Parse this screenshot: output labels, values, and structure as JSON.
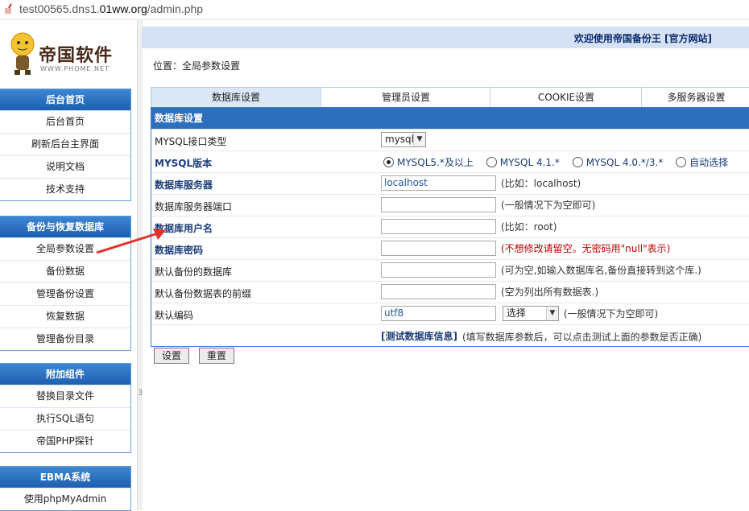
{
  "browser": {
    "url_prefix": "test00565.dns1.",
    "url_host": "01ww.org",
    "url_path": "/admin.php"
  },
  "logo": {
    "brand": "帝国软件",
    "site": "WWW.PHOME.NET"
  },
  "sidebar": {
    "menus": [
      {
        "header": "后台首页",
        "items": [
          "后台首页",
          "刷新后台主界面",
          "说明文档",
          "技术支持"
        ]
      },
      {
        "header": "备份与恢复数据库",
        "items": [
          "全局参数设置",
          "备份数据",
          "管理备份设置",
          "恢复数据",
          "管理备份目录"
        ]
      },
      {
        "header": "附加组件",
        "items": [
          "替换目录文件",
          "执行SQL语句",
          "帝国PHP探针"
        ]
      },
      {
        "header": "EBMA系统",
        "items": [
          "使用phpMyAdmin"
        ]
      }
    ]
  },
  "divider_number": "3",
  "header": {
    "welcome": "欢迎使用帝国备份王 [官方网站]"
  },
  "location": "位置：全局参数设置",
  "tabs": [
    "数据库设置",
    "管理员设置",
    "COOKIE设置",
    "多服务器设置"
  ],
  "form": {
    "title": "数据库设置",
    "rows": {
      "iface_label": "MYSQL接口类型",
      "iface_value": "mysql",
      "ver_label": "MYSQL版本",
      "ver_options": [
        "MYSQL5.*及以上",
        "MYSQL 4.1.*",
        "MYSQL 4.0.*/3.*",
        "自动选择"
      ],
      "server_label": "数据库服务器",
      "server_value": "localhost",
      "server_hint": "(比如：localhost)",
      "port_label": "数据库服务器端口",
      "port_value": "",
      "port_hint": "(一般情况下为空即可)",
      "user_label": "数据库用户名",
      "user_value": "",
      "user_hint": "(比如：root)",
      "pwd_label": "数据库密码",
      "pwd_value": "",
      "pwd_hint": "(不想修改请留空。无密码用\"null\"表示)",
      "db_label": "默认备份的数据库",
      "db_value": "",
      "db_hint": "(可为空,如输入数据库名,备份直接转到这个库.)",
      "prefix_label": "默认备份数据表的前缀",
      "prefix_value": "",
      "prefix_hint": "(空为列出所有数据表.)",
      "charset_label": "默认编码",
      "charset_value": "utf8",
      "charset_select": "选择",
      "charset_hint": "(一般情况下为空即可)",
      "test_link": "[测试数据库信息]",
      "test_hint": "(填写数据库参数后，可以点击测试上面的参数是否正确)"
    }
  },
  "buttons": {
    "submit": "设置",
    "reset": "重置"
  },
  "colors": {
    "menu_header": "#2a73c6",
    "form_title": "#2d6fbd",
    "arrow": "#e0312b",
    "warning": "#c00000"
  }
}
